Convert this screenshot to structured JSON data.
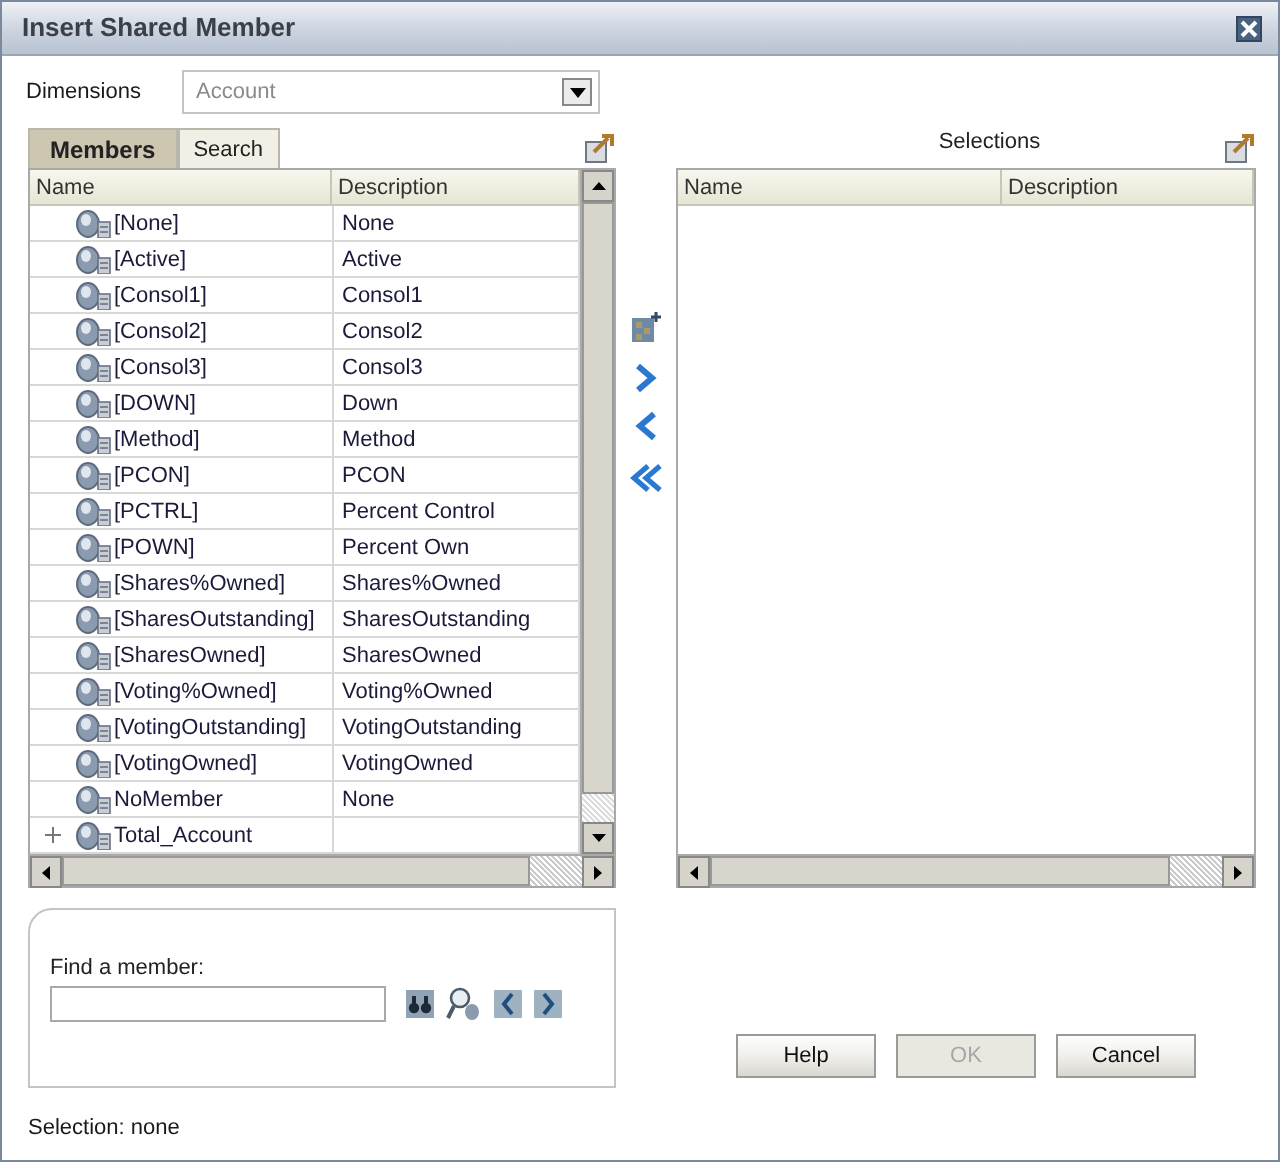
{
  "window": {
    "title": "Insert Shared Member"
  },
  "dimensions": {
    "label": "Dimensions",
    "value": "Account"
  },
  "tabs": [
    {
      "label": "Members",
      "selected": true
    },
    {
      "label": "Search",
      "selected": false
    }
  ],
  "members": {
    "columns": [
      "Name",
      "Description"
    ],
    "rows": [
      {
        "name": "[None]",
        "description": "None",
        "has_children": false
      },
      {
        "name": "[Active]",
        "description": "Active",
        "has_children": false
      },
      {
        "name": "[Consol1]",
        "description": "Consol1",
        "has_children": false
      },
      {
        "name": "[Consol2]",
        "description": "Consol2",
        "has_children": false
      },
      {
        "name": "[Consol3]",
        "description": "Consol3",
        "has_children": false
      },
      {
        "name": "[DOWN]",
        "description": "Down",
        "has_children": false
      },
      {
        "name": "[Method]",
        "description": "Method",
        "has_children": false
      },
      {
        "name": "[PCON]",
        "description": "PCON",
        "has_children": false
      },
      {
        "name": "[PCTRL]",
        "description": "Percent Control",
        "has_children": false
      },
      {
        "name": "[POWN]",
        "description": "Percent Own",
        "has_children": false
      },
      {
        "name": "[Shares%Owned]",
        "description": "Shares%Owned",
        "has_children": false
      },
      {
        "name": "[SharesOutstanding]",
        "description": "SharesOutstanding",
        "has_children": false
      },
      {
        "name": "[SharesOwned]",
        "description": "SharesOwned",
        "has_children": false
      },
      {
        "name": "[Voting%Owned]",
        "description": "Voting%Owned",
        "has_children": false
      },
      {
        "name": "[VotingOutstanding]",
        "description": "VotingOutstanding",
        "has_children": false
      },
      {
        "name": "[VotingOwned]",
        "description": "VotingOwned",
        "has_children": false
      },
      {
        "name": "NoMember",
        "description": "None",
        "has_children": false
      },
      {
        "name": "Total_Account",
        "description": "",
        "has_children": true
      }
    ]
  },
  "selections": {
    "title": "Selections",
    "columns": [
      "Name",
      "Description"
    ]
  },
  "find": {
    "label": "Find a member:"
  },
  "buttons": [
    {
      "label": "Help",
      "disabled": false
    },
    {
      "label": "OK",
      "disabled": true
    },
    {
      "label": "Cancel",
      "disabled": false
    }
  ],
  "status": "Selection: none"
}
